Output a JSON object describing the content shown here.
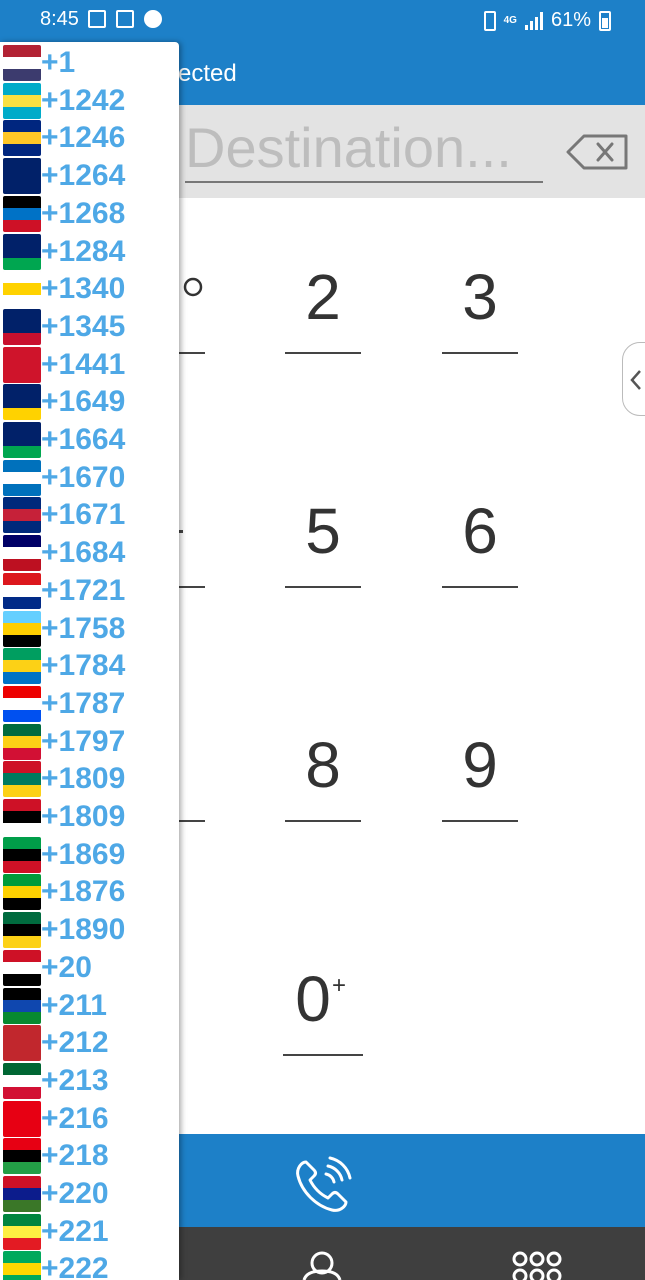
{
  "status_bar": {
    "time": "8:45",
    "network": "4G",
    "battery": "61%"
  },
  "header": {
    "title_partial": "ected"
  },
  "destination": {
    "placeholder": "Destination..."
  },
  "keypad": {
    "visible_keys": [
      "2",
      "3",
      "5",
      "6",
      "8",
      "9",
      "0"
    ],
    "zero_superscript": "+"
  },
  "colors": {
    "primary": "#1d80c8",
    "code_text": "#4ea8e6",
    "bottom_bar": "#3f3f3f"
  },
  "country_codes": [
    {
      "code": "+1",
      "flag": [
        "#b22234",
        "#ffffff",
        "#3c3b6e"
      ]
    },
    {
      "code": "+1242",
      "flag": [
        "#00abc9",
        "#fae042",
        "#00abc9"
      ]
    },
    {
      "code": "+1246",
      "flag": [
        "#00267f",
        "#ffc726",
        "#00267f"
      ]
    },
    {
      "code": "+1264",
      "flag": [
        "#012169",
        "#012169",
        "#012169"
      ]
    },
    {
      "code": "+1268",
      "flag": [
        "#000000",
        "#0072c6",
        "#ce1126"
      ]
    },
    {
      "code": "+1284",
      "flag": [
        "#012169",
        "#012169",
        "#00a650"
      ]
    },
    {
      "code": "+1340",
      "flag": [
        "#ffffff",
        "#ffd200",
        "#ffffff"
      ]
    },
    {
      "code": "+1345",
      "flag": [
        "#012169",
        "#012169",
        "#c8102e"
      ]
    },
    {
      "code": "+1441",
      "flag": [
        "#cf142b",
        "#cf142b",
        "#cf142b"
      ]
    },
    {
      "code": "+1649",
      "flag": [
        "#012169",
        "#012169",
        "#ffd200"
      ]
    },
    {
      "code": "+1664",
      "flag": [
        "#012169",
        "#012169",
        "#00a650"
      ]
    },
    {
      "code": "+1670",
      "flag": [
        "#0071bc",
        "#ffffff",
        "#0071bc"
      ]
    },
    {
      "code": "+1671",
      "flag": [
        "#00297b",
        "#c62139",
        "#00297b"
      ]
    },
    {
      "code": "+1684",
      "flag": [
        "#000066",
        "#ffffff",
        "#bd1021"
      ]
    },
    {
      "code": "+1721",
      "flag": [
        "#dc171d",
        "#ffffff",
        "#012a87"
      ]
    },
    {
      "code": "+1758",
      "flag": [
        "#65cfff",
        "#ffce00",
        "#000000"
      ]
    },
    {
      "code": "+1784",
      "flag": [
        "#009e60",
        "#fcd116",
        "#0072c6"
      ]
    },
    {
      "code": "+1787",
      "flag": [
        "#ed0000",
        "#ffffff",
        "#0050f0"
      ]
    },
    {
      "code": "+1797",
      "flag": [
        "#006b3f",
        "#fcd116",
        "#d21034"
      ]
    },
    {
      "code": "+1809",
      "flag": [
        "#ce1126",
        "#007a5e",
        "#fcd116"
      ]
    },
    {
      "code": "+1809",
      "flag": [
        "#ce1126",
        "#000000",
        "#ffffff"
      ]
    },
    {
      "code": "+1869",
      "flag": [
        "#009e49",
        "#000000",
        "#ce1126"
      ]
    },
    {
      "code": "+1876",
      "flag": [
        "#009b3a",
        "#fed100",
        "#000000"
      ]
    },
    {
      "code": "+1890",
      "flag": [
        "#006b3f",
        "#000000",
        "#fcd116"
      ]
    },
    {
      "code": "+20",
      "flag": [
        "#ce1126",
        "#ffffff",
        "#000000"
      ]
    },
    {
      "code": "+211",
      "flag": [
        "#000000",
        "#0f47af",
        "#078930"
      ]
    },
    {
      "code": "+212",
      "flag": [
        "#c1272d",
        "#c1272d",
        "#c1272d"
      ]
    },
    {
      "code": "+213",
      "flag": [
        "#006633",
        "#ffffff",
        "#d21034"
      ]
    },
    {
      "code": "+216",
      "flag": [
        "#e70013",
        "#e70013",
        "#e70013"
      ]
    },
    {
      "code": "+218",
      "flag": [
        "#e70013",
        "#000000",
        "#239e46"
      ]
    },
    {
      "code": "+220",
      "flag": [
        "#ce1126",
        "#0c1c8c",
        "#3a7728"
      ]
    },
    {
      "code": "+221",
      "flag": [
        "#00853f",
        "#fdef42",
        "#e31b23"
      ]
    },
    {
      "code": "+222",
      "flag": [
        "#00a95c",
        "#ffd700",
        "#00a95c"
      ]
    }
  ]
}
